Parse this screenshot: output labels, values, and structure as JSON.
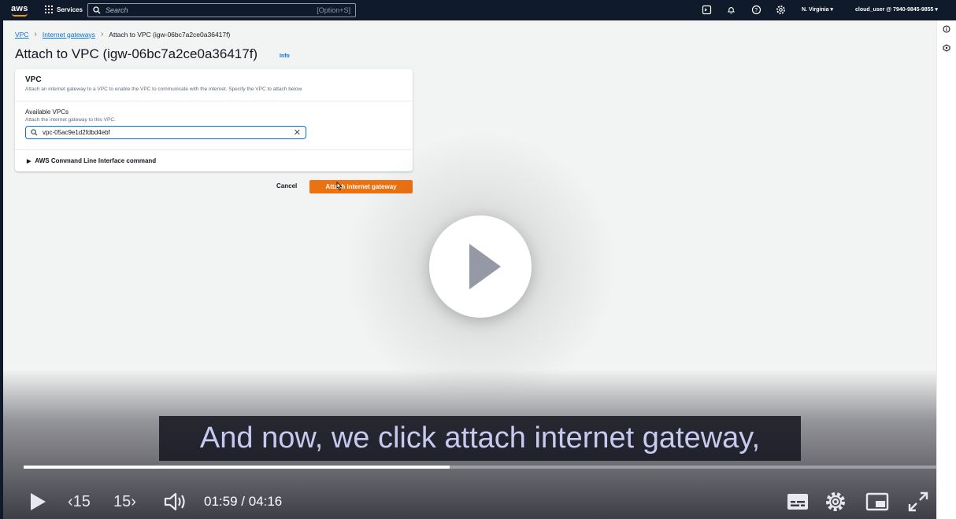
{
  "topnav": {
    "logo": "aws",
    "services_label": "Services",
    "search_placeholder": "Search",
    "search_shortcut": "[Option+S]",
    "region": "N. Virginia ▾",
    "account": "cloud_user @ 7940-9845-9855 ▾"
  },
  "breadcrumb": {
    "items": [
      "VPC",
      "Internet gateways",
      "Attach to VPC (igw-06bc7a2ce0a36417f)"
    ]
  },
  "page": {
    "title": "Attach to VPC (igw-06bc7a2ce0a36417f)",
    "info_link": "Info"
  },
  "panel": {
    "title": "VPC",
    "description": "Attach an internet gateway to a VPC to enable the VPC to communicate with the internet. Specify the VPC to attach below.",
    "field_label": "Available VPCs",
    "field_description": "Attach the internet gateway to this VPC.",
    "field_value": "vpc-05ac9e1d2fdbd4ebf",
    "cli_toggle": "AWS Command Line Interface command"
  },
  "actions": {
    "cancel": "Cancel",
    "attach": "Attach internet gateway"
  },
  "video": {
    "caption": "And now, we click attach internet gateway,",
    "progress": 0.467,
    "back_label": "‹15",
    "forward_label": "15›",
    "current_time": "01:59",
    "duration": "04:16",
    "time_display": "01:59 / 04:16"
  },
  "colors": {
    "nav_bg": "#0f1b2a",
    "link": "#0972d3",
    "primary_button": "#ec7211",
    "caption_text": "#c7c9f0"
  }
}
